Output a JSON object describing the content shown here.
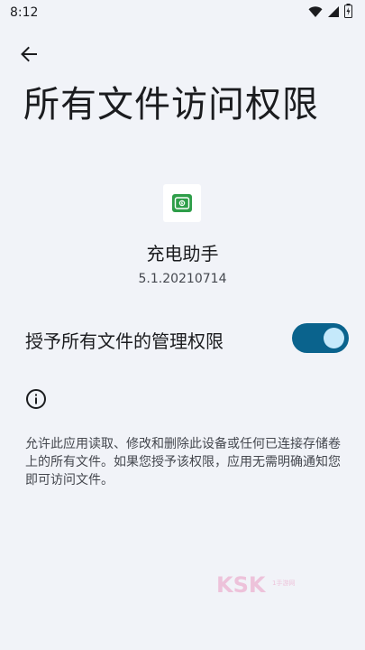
{
  "status_bar": {
    "time": "8:12",
    "icons": [
      "wifi-icon",
      "signal-icon",
      "battery-icon"
    ]
  },
  "header": {
    "back_icon": "arrow-back-icon",
    "title": "所有文件访问权限"
  },
  "app": {
    "icon": "charging-assistant-app-icon",
    "name": "充电助手",
    "version": "5.1.20210714"
  },
  "permission": {
    "label": "授予所有文件的管理权限",
    "enabled": true
  },
  "info": {
    "icon": "info-icon",
    "description": "允许此应用读取、修改和删除此设备或任何已连接存储卷上的所有文件。如果您授予该权限，应用无需明确通知您即可访问文件。"
  },
  "watermark": {
    "text": "KSK",
    "sub_text": "1手游网"
  },
  "colors": {
    "background": "#f1f3f8",
    "toggle_track": "#0a638d",
    "toggle_thumb": "#c5e9fb",
    "app_icon_green": "#2e9e49"
  }
}
